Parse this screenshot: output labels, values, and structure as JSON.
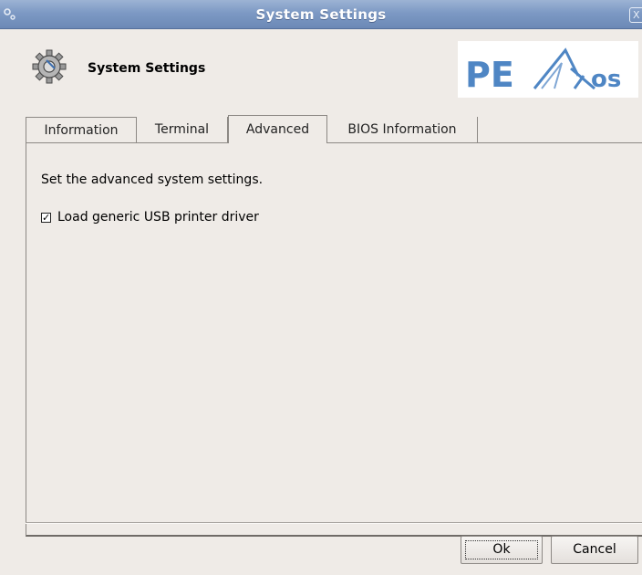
{
  "window": {
    "title": "System Settings",
    "close_label": "X"
  },
  "header": {
    "title": "System Settings",
    "icon": "gear-icon",
    "logo_text": "PEAKos"
  },
  "tabs": [
    {
      "label": "Information",
      "active": false
    },
    {
      "label": "Terminal",
      "active": false
    },
    {
      "label": "Advanced",
      "active": true
    },
    {
      "label": "BIOS Information",
      "active": false
    }
  ],
  "panel": {
    "description": "Set the advanced system settings.",
    "checkbox_label": "Load generic USB printer driver",
    "checkbox_checked": true
  },
  "buttons": {
    "ok": "Ok",
    "cancel": "Cancel"
  },
  "colors": {
    "titlebar": "#7d99c4",
    "logo_blue": "#4f86c4"
  }
}
